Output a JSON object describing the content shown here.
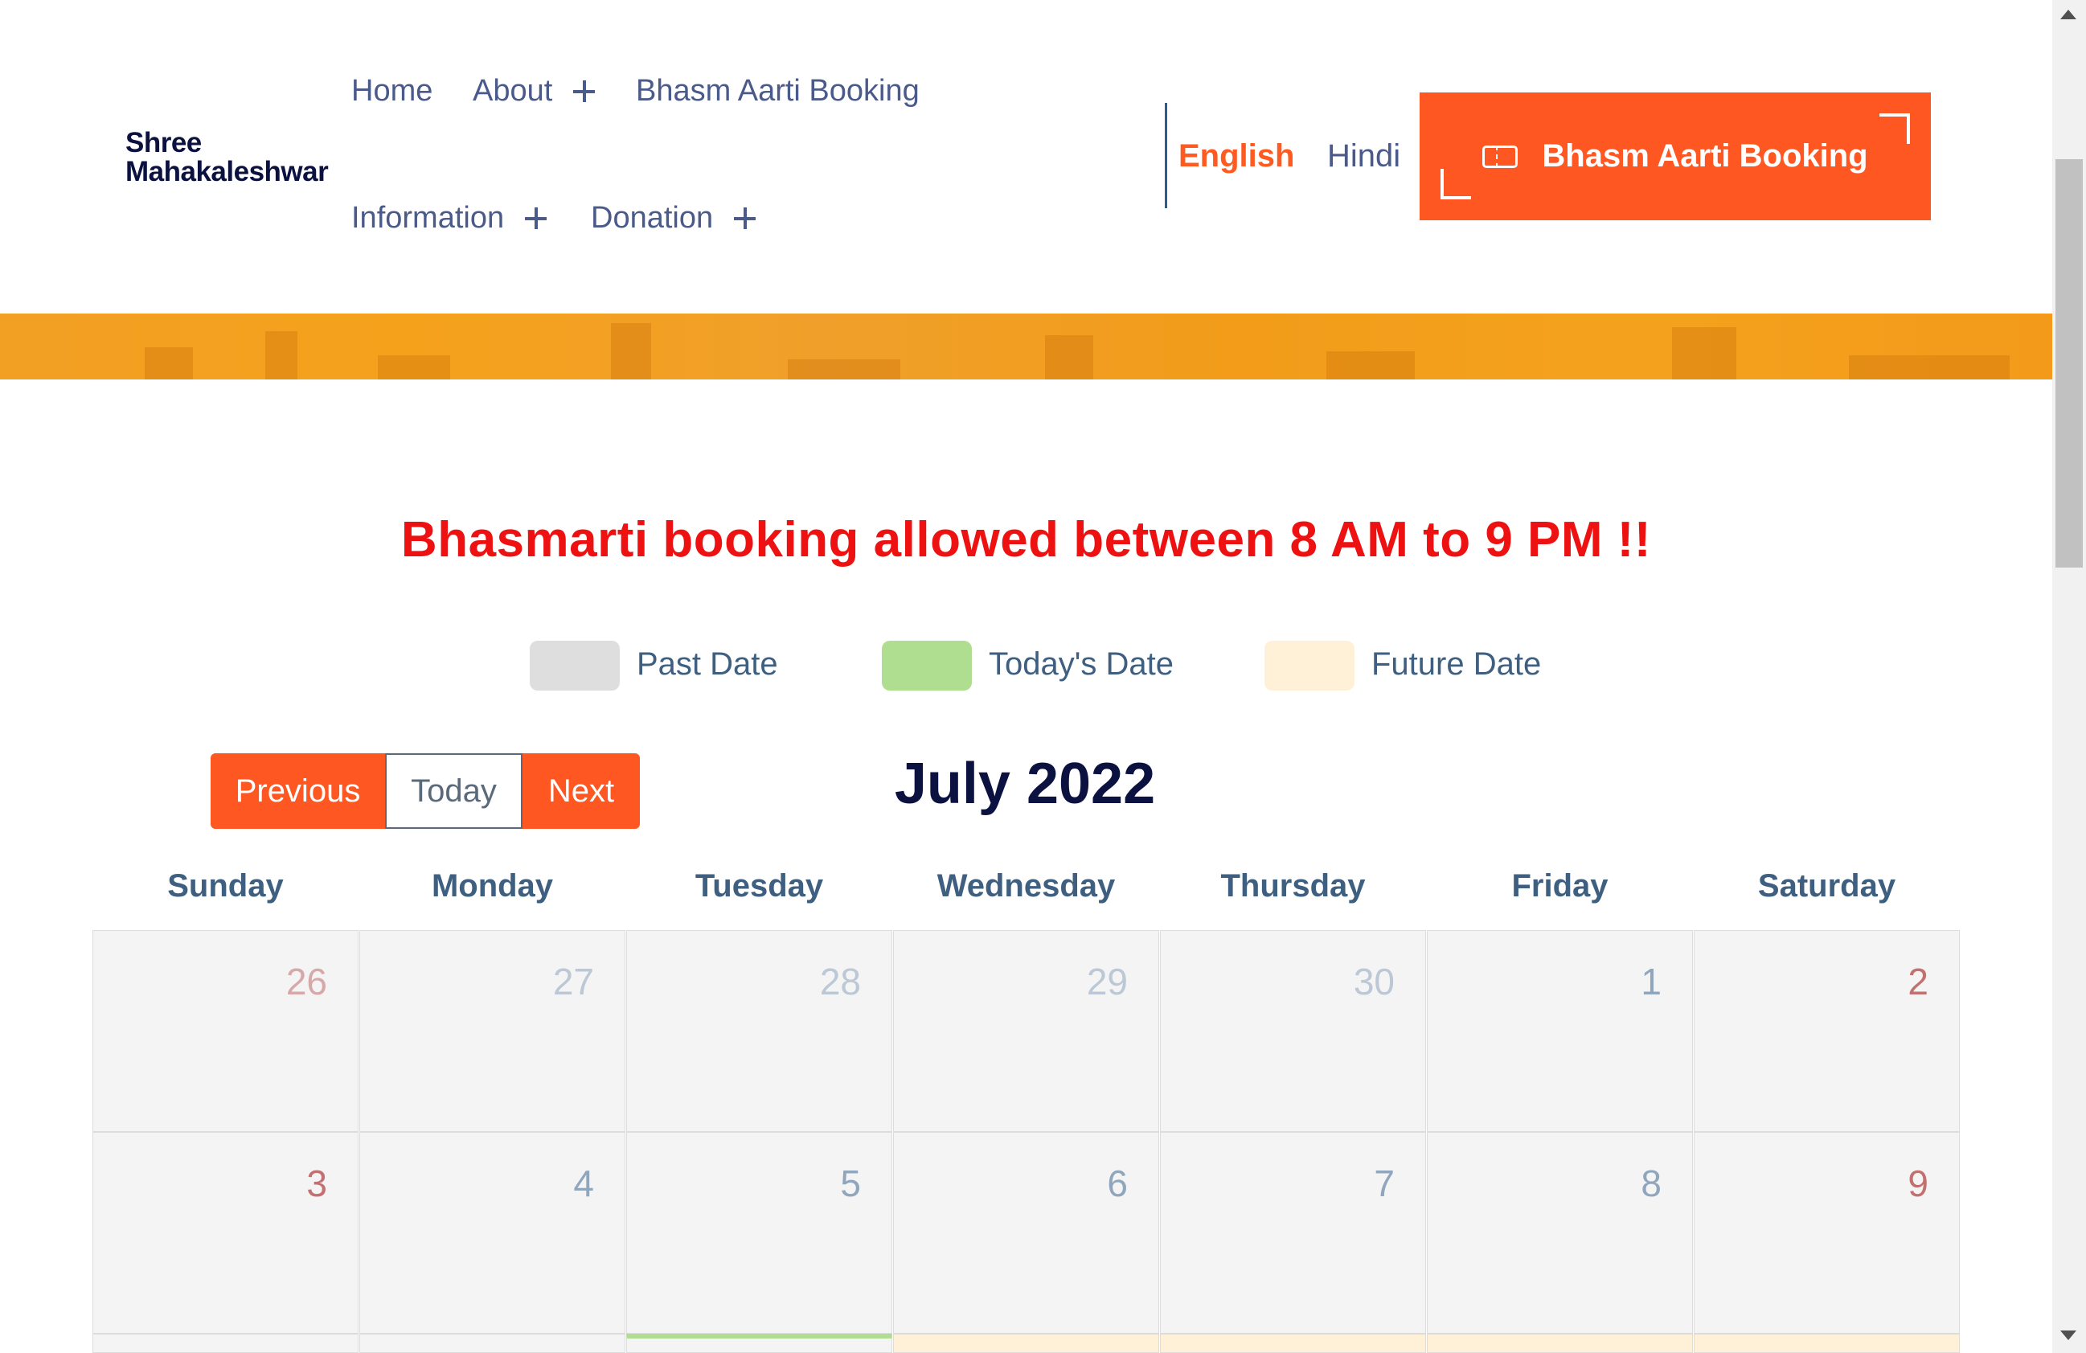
{
  "header": {
    "logo": {
      "line1": "Shree",
      "line2": "Mahakaleshwar"
    },
    "nav": [
      {
        "label": "Home"
      },
      {
        "label": "About"
      },
      {
        "label": "Bhasm Aarti Booking"
      },
      {
        "label": "Information"
      },
      {
        "label": "Donation"
      }
    ],
    "languages": {
      "english": "English",
      "hindi": "Hindi",
      "active": "English"
    },
    "cta": {
      "label": "Bhasm Aarti Booking",
      "icon": "ticket-icon"
    }
  },
  "notice": "Bhasmarti booking allowed between 8 AM to 9 PM !!",
  "legend": [
    {
      "label": "Past Date",
      "color": "#dedede"
    },
    {
      "label": "Today's Date",
      "color": "#b0de90"
    },
    {
      "label": "Future Date",
      "color": "#fff0d8"
    }
  ],
  "calendar": {
    "controls": {
      "previous": "Previous",
      "today": "Today",
      "next": "Next"
    },
    "month_title": "July 2022",
    "weekdays": [
      "Sunday",
      "Monday",
      "Tuesday",
      "Wednesday",
      "Thursday",
      "Friday",
      "Saturday"
    ],
    "weeks": [
      [
        "26",
        "27",
        "28",
        "29",
        "30",
        "1",
        "2"
      ],
      [
        "3",
        "4",
        "5",
        "6",
        "7",
        "8",
        "9"
      ]
    ]
  },
  "colors": {
    "accent": "#ff5722",
    "notice": "#ee1111",
    "nav_text": "#4a5a8a",
    "title": "#0c1240",
    "past_cell": "#f4f4f4",
    "today_cell": "#b0de90",
    "future_cell": "#fff0d8"
  }
}
